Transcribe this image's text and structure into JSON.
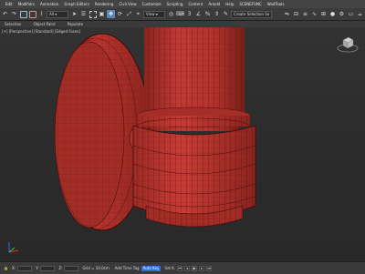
{
  "menubar": {
    "items": [
      "Edit",
      "Modifiers",
      "Animation",
      "Graph Editors",
      "Rendering",
      "Civil View",
      "Customize",
      "Scripting",
      "Content",
      "Arnold",
      "Help",
      "SCENEFUNC",
      "WaitTools"
    ]
  },
  "toolbar": {
    "selection_set": "All",
    "view": "View",
    "create_selection_set": "Create Selection Se"
  },
  "ribbon": {
    "tabs": [
      "Selection",
      "Object Paint",
      "Populate"
    ]
  },
  "viewport": {
    "label": "[+] [Perspective] [Standard] [Edged Faces]",
    "model_color": "#b8342e",
    "wire_color": "#4a0e0c"
  },
  "statusbar": {
    "x_label": "X:",
    "y_label": "Y:",
    "z_label": "Z:",
    "grid": "Grid = 10,0cm",
    "add_time_tag": "Add Time Tag",
    "auto_key": "Auto Key",
    "set_key": "Set K."
  },
  "colors": {
    "accent": "#5a86b8",
    "ui_dark": "#3b3b3b"
  }
}
